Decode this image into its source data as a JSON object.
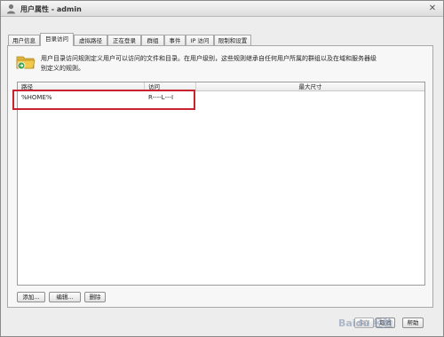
{
  "window": {
    "title": "用户属性 - admin",
    "close_glyph": "✕"
  },
  "tabs": [
    {
      "label": "用户信息",
      "active": false
    },
    {
      "label": "目录访问",
      "active": true
    },
    {
      "label": "虚拟路径",
      "active": false
    },
    {
      "label": "正在登录",
      "active": false
    },
    {
      "label": "群组",
      "active": false
    },
    {
      "label": "事件",
      "active": false
    },
    {
      "label": "IP 访问",
      "active": false
    },
    {
      "label": "限制和设置",
      "active": false
    }
  ],
  "description": {
    "line1": "用户目录访问规则定义用户可以访问的文件和目录。在用户级别，这些规则继承自任何用户所属的群组以及在域和服务器级",
    "line2": "别定义的规则。"
  },
  "table": {
    "columns": [
      "路径",
      "访问",
      "最大尺寸"
    ],
    "rows": [
      {
        "path": "%HOME%",
        "access": "R----L---I",
        "max_size": ""
      }
    ]
  },
  "list_buttons": {
    "add": "添加...",
    "edit": "编辑...",
    "delete": "删除"
  },
  "footer_buttons": {
    "save": "保存",
    "cancel": "取消",
    "help": "帮助"
  },
  "watermark": "Baidu 经验",
  "colors": {
    "highlight_border": "#c8232e",
    "folder": "#f2c94c",
    "folder_badge": "#3fa34d"
  }
}
